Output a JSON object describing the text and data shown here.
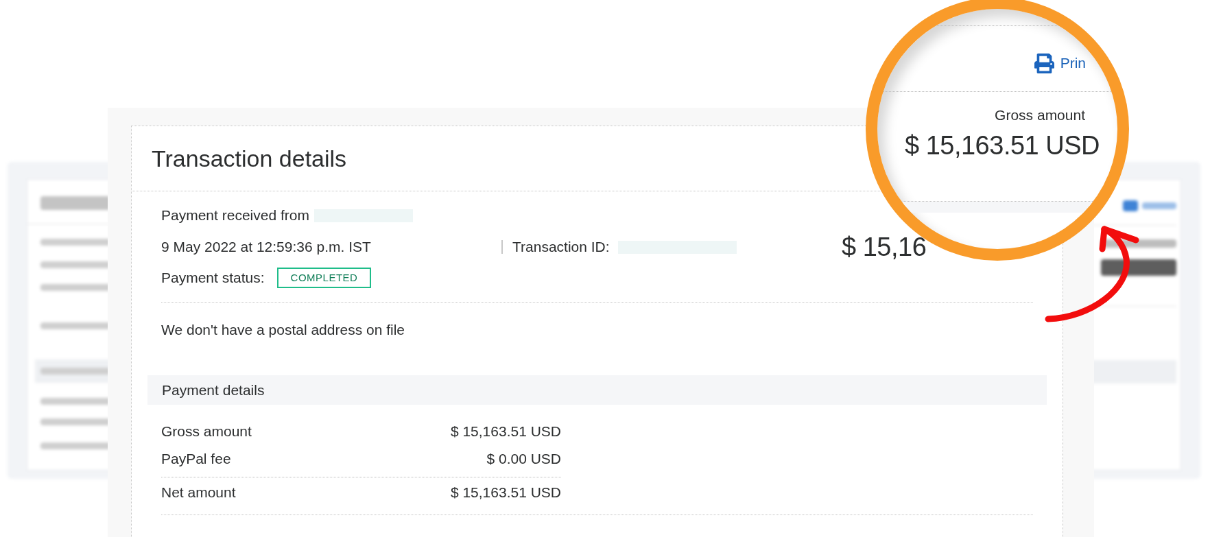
{
  "page": {
    "title": "Transaction details"
  },
  "summary": {
    "received_label": "Payment received from",
    "date": "9 May 2022 at 12:59:36 p.m. IST",
    "transaction_id_label": "Transaction ID:",
    "amount": "$ 15,16",
    "status_label": "Payment status:",
    "status": {
      "label": "COMPLETED",
      "kind": "completed"
    }
  },
  "address_note": "We don't have a postal address on file",
  "payment_details": {
    "title": "Payment details",
    "rows": [
      {
        "kind": "line",
        "label": "Gross amount",
        "value": "$ 15,163.51 USD"
      },
      {
        "kind": "line",
        "label": "PayPal fee",
        "value": "$ 0.00 USD"
      },
      {
        "kind": "total",
        "label": "Net amount",
        "value": "$ 15,163.51 USD"
      }
    ]
  },
  "magnifier": {
    "print_link": "Prin",
    "amount_label": "Gross amount",
    "amount": "$ 15,163.51 USD"
  }
}
